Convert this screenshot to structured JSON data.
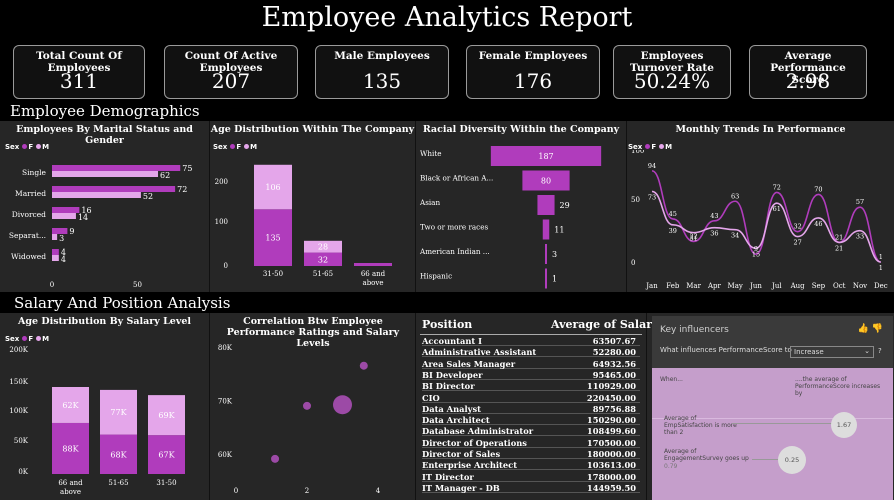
{
  "title": "Employee Analytics Report",
  "kpis": [
    {
      "label": "Total Count Of Employees",
      "value": "311"
    },
    {
      "label": "Count Of Active Employees",
      "value": "207"
    },
    {
      "label": "Male Employees",
      "value": "135"
    },
    {
      "label": "Female Employees",
      "value": "176"
    },
    {
      "label": "Employees Turnover Rate",
      "value": "50.24%"
    },
    {
      "label": "Average Performance Score",
      "value": "2.98"
    }
  ],
  "sections": {
    "demographics": "Employee Demographics",
    "salary": "Salary And Position Analysis"
  },
  "legend": {
    "label": "Sex",
    "f": "F",
    "m": "M"
  },
  "colors": {
    "female": "#b03cbc",
    "male": "#e4a6ea",
    "panel": "#262626"
  },
  "marital": {
    "title": "Employees By Marital Status and Gender",
    "categories": [
      "Single",
      "Married",
      "Divorced",
      "Separat...",
      "Widowed"
    ],
    "female": [
      75,
      72,
      16,
      9,
      4
    ],
    "male": [
      62,
      52,
      14,
      3,
      4
    ],
    "ticks": [
      "0",
      "50"
    ]
  },
  "age_dist": {
    "title": "Age Distribution Within The Company",
    "categories": [
      "31-50",
      "51-65",
      "66 and above"
    ],
    "female": [
      135,
      32,
      0
    ],
    "male": [
      106,
      28,
      0
    ],
    "yticks": [
      "200",
      "100",
      "0"
    ]
  },
  "racial": {
    "title": "Racial Diversity Within the Company",
    "categories": [
      "White",
      "Black or African A...",
      "Asian",
      "Two or more races",
      "American Indian ...",
      "Hispanic"
    ],
    "values": [
      187,
      80,
      29,
      11,
      3,
      1
    ]
  },
  "monthly": {
    "title": "Monthly Trends In Performance",
    "months": [
      "Jan",
      "Feb",
      "Mar",
      "Apr",
      "May",
      "Jun",
      "Jul",
      "Aug",
      "Sep",
      "Oct",
      "Nov",
      "Dec"
    ],
    "female": [
      94,
      45,
      22,
      43,
      63,
      9,
      72,
      32,
      70,
      21,
      57,
      1
    ],
    "male": [
      73,
      39,
      31,
      36,
      34,
      15,
      61,
      27,
      46,
      21,
      33,
      1
    ],
    "yticks": [
      "100",
      "50",
      "0"
    ]
  },
  "salary_age": {
    "title": "Age Distribution By Salary Level",
    "categories": [
      "66 and above",
      "51-65",
      "31-50"
    ],
    "female": [
      "88K",
      "68K",
      "67K"
    ],
    "male": [
      "62K",
      "77K",
      "69K"
    ],
    "yticks": [
      "200K",
      "150K",
      "100K",
      "50K",
      "0K"
    ]
  },
  "correlation": {
    "title": "Correlation Btw Employee Performance Ratings and Salary Levels",
    "yticks": [
      "80K",
      "70K",
      "60K"
    ],
    "xticks": [
      "0",
      "2",
      "4"
    ],
    "points": [
      {
        "x": 3.6,
        "y": 76.5,
        "r": "small"
      },
      {
        "x": 2.0,
        "y": 69.0,
        "r": "small"
      },
      {
        "x": 3.0,
        "y": 69.2,
        "r": "large"
      },
      {
        "x": 1.1,
        "y": 59.1,
        "r": "small"
      }
    ]
  },
  "positions": {
    "col1": "Position",
    "col2": "Average of Salary",
    "rows": [
      [
        "Accountant I",
        "63507.67"
      ],
      [
        "Administrative Assistant",
        "52280.00"
      ],
      [
        "Area Sales Manager",
        "64932.56"
      ],
      [
        "BI Developer",
        "95465.00"
      ],
      [
        "BI Director",
        "110929.00"
      ],
      [
        "CIO",
        "220450.00"
      ],
      [
        "Data Analyst",
        "89756.88"
      ],
      [
        "Data Architect",
        "150290.00"
      ],
      [
        "Database Administrator",
        "108499.60"
      ],
      [
        "Director of Operations",
        "170500.00"
      ],
      [
        "Director of Sales",
        "180000.00"
      ],
      [
        "Enterprise Architect",
        "103613.00"
      ],
      [
        "IT Director",
        "178000.00"
      ],
      [
        "IT Manager - DB",
        "144959.50"
      ]
    ]
  },
  "influencers": {
    "title": "Key influencers",
    "question": "What influences PerformanceScore to",
    "select": "Increase",
    "help": "?",
    "when": "When...",
    "avg": "....the average of PerformanceScore increases by",
    "items": [
      {
        "label": "Average of EmpSatisfaction is more than 2",
        "value": "1.67"
      },
      {
        "label": "Average of EngagementSurvey goes up",
        "sub": "0.79",
        "value": "0.25"
      }
    ]
  }
}
